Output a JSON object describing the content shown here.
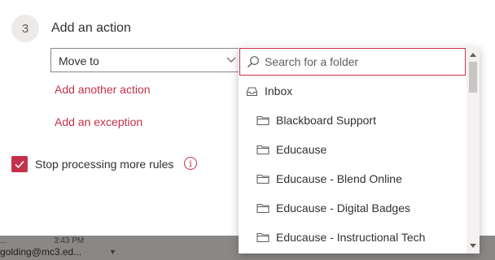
{
  "background": {
    "row1_text": "...",
    "row1_time": "3:43 PM",
    "row2_text": "golding@mc3.ed..."
  },
  "step": {
    "number": "3",
    "title": "Add an action"
  },
  "action_select": {
    "value": "Move to"
  },
  "links": {
    "add_another_action": "Add another action",
    "add_exception": "Add an exception"
  },
  "stop_processing": {
    "label": "Stop processing more rules",
    "checked": true
  },
  "folder_picker": {
    "search_placeholder": "Search for a folder",
    "items": [
      {
        "label": "Inbox",
        "icon": "inbox-icon"
      },
      {
        "label": "Blackboard Support",
        "icon": "folder-icon"
      },
      {
        "label": "Educause",
        "icon": "folder-icon"
      },
      {
        "label": "Educause - Blend Online",
        "icon": "folder-icon"
      },
      {
        "label": "Educause - Digital Badges",
        "icon": "folder-icon"
      },
      {
        "label": "Educause - Instructional Tech",
        "icon": "folder-icon"
      }
    ]
  },
  "colors": {
    "accent": "#c4314b",
    "text": "#323130",
    "border": "#8a8886"
  }
}
